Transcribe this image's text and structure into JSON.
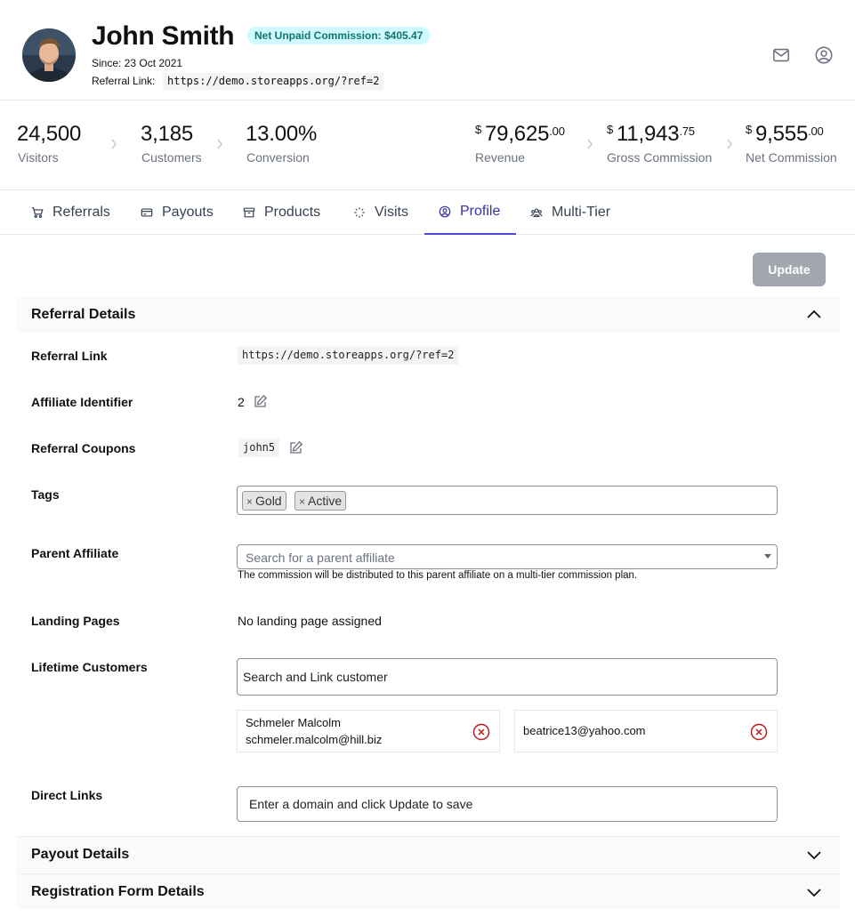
{
  "profile": {
    "name": "John Smith",
    "badge": "Net Unpaid Commission: $405.47",
    "since": "Since: 23 Oct 2021",
    "referral_label": "Referral Link:",
    "referral_link": "https://demo.storeapps.org/?ref=2",
    "icons": [
      "mail-icon",
      "user-circle-icon"
    ]
  },
  "stats": {
    "visitors": {
      "value": "24,500",
      "label": "Visitors"
    },
    "customers": {
      "value": "3,185",
      "label": "Customers"
    },
    "conversion": {
      "value": "13.00%",
      "label": "Conversion"
    },
    "revenue": {
      "currency": "$",
      "whole": "79,625",
      "cents": ".00",
      "label": "Revenue"
    },
    "gross": {
      "currency": "$",
      "whole": "11,943",
      "cents": ".75",
      "label": "Gross Commission"
    },
    "net": {
      "currency": "$",
      "whole": "9,555",
      "cents": ".00",
      "label": "Net Commission"
    }
  },
  "tabs": [
    {
      "label": "Referrals",
      "icon": "cart-icon"
    },
    {
      "label": "Payouts",
      "icon": "card-icon"
    },
    {
      "label": "Products",
      "icon": "box-icon"
    },
    {
      "label": "Visits",
      "icon": "sparkle-icon"
    },
    {
      "label": "Profile",
      "icon": "user-circle-icon",
      "active": true
    },
    {
      "label": "Multi-Tier",
      "icon": "users-icon"
    }
  ],
  "update_button": "Update",
  "sections": {
    "referral_details": "Referral Details",
    "payout_details": "Payout Details",
    "registration_form_details": "Registration Form Details"
  },
  "fields": {
    "referral_link": {
      "label": "Referral Link",
      "value": "https://demo.storeapps.org/?ref=2"
    },
    "affiliate_identifier": {
      "label": "Affiliate Identifier",
      "value": "2"
    },
    "referral_coupons": {
      "label": "Referral Coupons",
      "value": "john5"
    },
    "tags": {
      "label": "Tags",
      "items": [
        "Gold",
        "Active"
      ],
      "remove_glyph": "×"
    },
    "parent_affiliate": {
      "label": "Parent Affiliate",
      "placeholder": "Search for a parent affiliate",
      "help": "The commission will be distributed to this parent affiliate on a multi-tier commission plan."
    },
    "landing_pages": {
      "label": "Landing Pages",
      "value": "No landing page assigned"
    },
    "lifetime_customers": {
      "label": "Lifetime Customers",
      "placeholder": "Search and Link customer",
      "customers": [
        {
          "name": "Schmeler Malcolm",
          "email": "schmeler.malcolm@hill.biz"
        },
        {
          "name": "",
          "email": "beatrice13@yahoo.com"
        }
      ]
    },
    "direct_links": {
      "label": "Direct Links",
      "placeholder": "Enter a domain and click Update to save"
    }
  },
  "colors": {
    "accent": "#4f46e5",
    "badge_bg": "#cffafe",
    "badge_text": "#0f766e",
    "remove_icon": "#b91c1c",
    "update_disabled": "#a1a6af"
  }
}
